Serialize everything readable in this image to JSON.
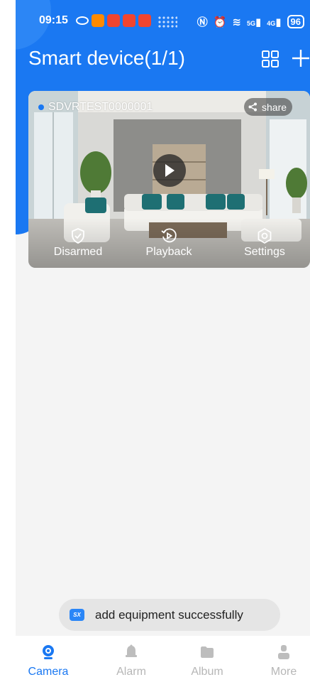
{
  "status_bar": {
    "time": "09:15",
    "network_5g": "5G",
    "network_4g": "4G",
    "battery": "96"
  },
  "header": {
    "title": "Smart device(1/1)",
    "grid_icon": "grid-view-icon",
    "add_icon": "plus-icon"
  },
  "device_card": {
    "name": "SDVRTEST0000001",
    "online": true,
    "share_label": "share",
    "actions": [
      {
        "label": "Disarmed",
        "icon": "shield-check-icon"
      },
      {
        "label": "Playback",
        "icon": "playback-icon"
      },
      {
        "label": "Settings",
        "icon": "settings-icon"
      }
    ]
  },
  "toast": {
    "logo": "SX",
    "message": "add equipment successfully"
  },
  "tabbar": {
    "tabs": [
      {
        "label": "Camera",
        "icon": "camera-icon",
        "active": true
      },
      {
        "label": "Alarm",
        "icon": "bell-icon",
        "active": false
      },
      {
        "label": "Album",
        "icon": "folder-icon",
        "active": false
      },
      {
        "label": "More",
        "icon": "user-icon",
        "active": false
      }
    ]
  },
  "colors": {
    "primary": "#1a78f2",
    "inactive": "#b6b6b6",
    "background": "#f4f4f4"
  }
}
